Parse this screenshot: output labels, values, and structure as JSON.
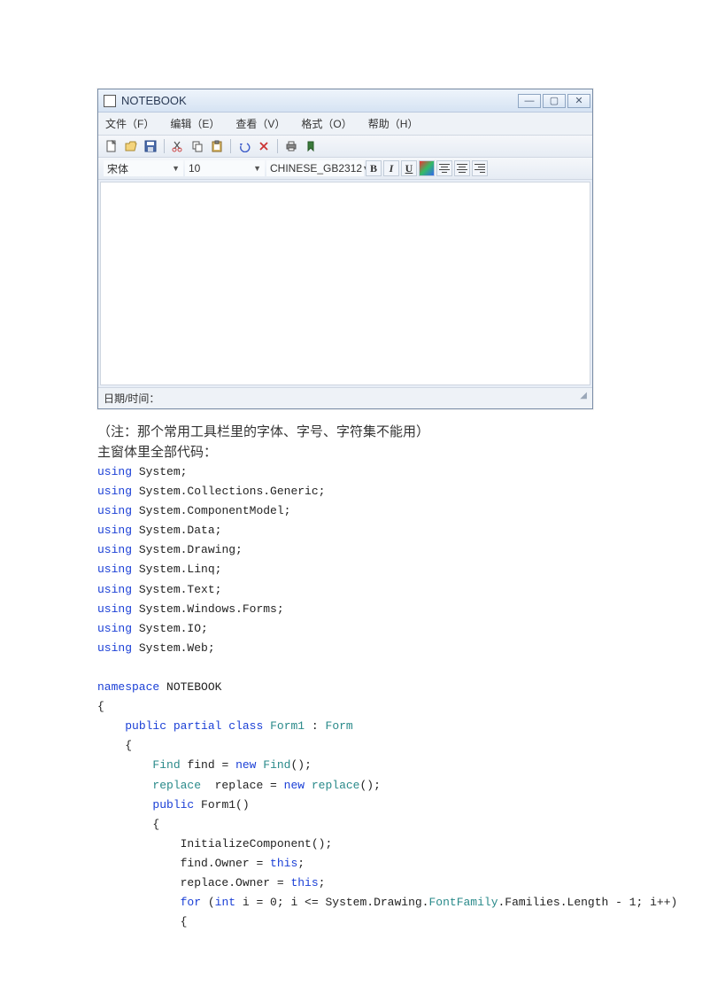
{
  "window": {
    "title": "NOTEBOOK"
  },
  "menu": {
    "file": "文件（F）",
    "edit": "编辑（E）",
    "view": "查看（V）",
    "format": "格式（O）",
    "help": "帮助（H）"
  },
  "toolbar2": {
    "font": "宋体",
    "size": "10",
    "charset": "CHINESE_GB2312",
    "bold": "B",
    "italic": "I",
    "underline": "U"
  },
  "statusbar": {
    "datetime_label": "日期/时间："
  },
  "doc": {
    "note": "（注：那个常用工具栏里的字体、字号、字符集不能用）",
    "heading": "主窗体里全部代码：",
    "usings": [
      "System;",
      "System.Collections.Generic;",
      "System.ComponentModel;",
      "System.Data;",
      "System.Drawing;",
      "System.Linq;",
      "System.Text;",
      "System.Windows.Forms;",
      "System.IO;",
      "System.Web;"
    ],
    "ns": "NOTEBOOK",
    "class": "Form1",
    "base": "Form",
    "find_type": "Find",
    "find_init": " find = ",
    "find_ctor": "Find",
    "replace_type": "replace",
    "replace_init": "  replace = ",
    "replace_ctor": "replace",
    "ctor_name": " Form1()",
    "init": "InitializeComponent();",
    "find_owner": "find.Owner = ",
    "replace_owner": "replace.Owner = ",
    "for_pre": " (",
    "for_int": "int",
    "for_mid": " i = 0; i <= System.Drawing.",
    "for_ff": "FontFamily",
    "for_tail": ".Families.Length - 1; i++)"
  },
  "kw": {
    "using": "using",
    "namespace": "namespace",
    "public": "public",
    "partial": "partial",
    "class": "class",
    "new": "new",
    "this": "this",
    "for": "for"
  }
}
